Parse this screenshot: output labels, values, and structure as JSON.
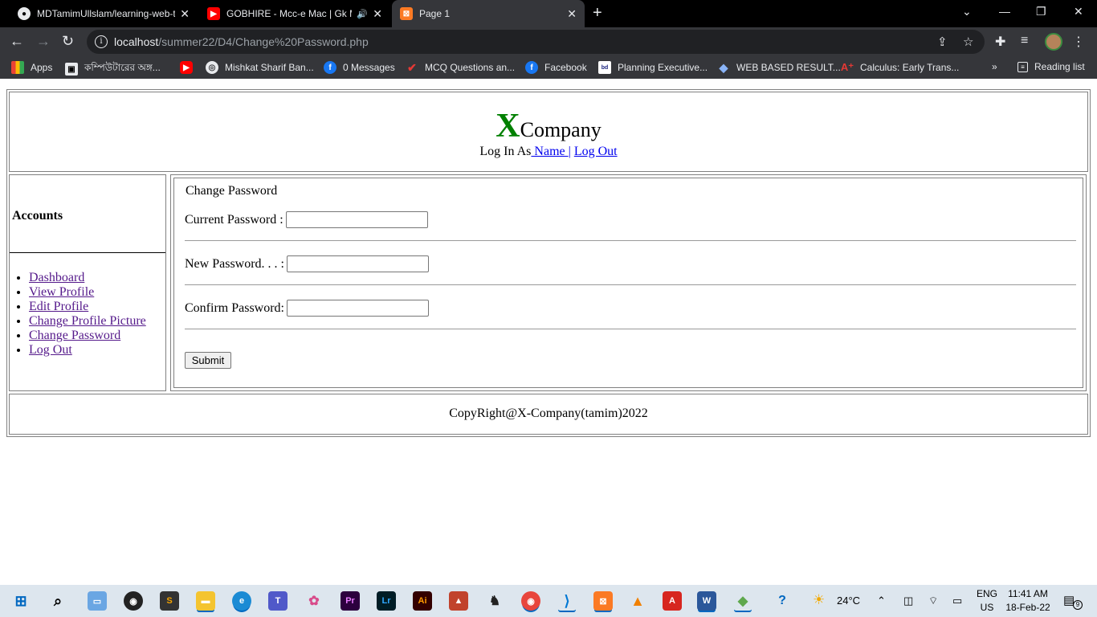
{
  "browser": {
    "tabs": [
      {
        "title": "MDTamimUllslam/learning-web-t",
        "favicon": "github-icon"
      },
      {
        "title": "GOBHIRE - Mcc-e Mac | Gk Ma",
        "favicon": "youtube-icon"
      },
      {
        "title": "Page 1",
        "favicon": "xampp-icon"
      }
    ],
    "url_host": "localhost",
    "url_path": "/summer22/D4/Change%20Password.php",
    "bookmarks": [
      {
        "label": "Apps"
      },
      {
        "label": "কম্পিউটারের অঙ্গ..."
      },
      {
        "label": ""
      },
      {
        "label": "Mishkat Sharif Ban..."
      },
      {
        "label": "0 Messages"
      },
      {
        "label": "MCQ Questions an..."
      },
      {
        "label": "Facebook"
      },
      {
        "label": "Planning Executive..."
      },
      {
        "label": "WEB BASED RESULT..."
      },
      {
        "label": "Calculus: Early Trans..."
      }
    ],
    "more_bookmarks": "»",
    "reading_list": "Reading list"
  },
  "header": {
    "brand_letter": "X",
    "brand_rest": "Company",
    "login_prefix": "Log In As",
    "user_link": " Name ",
    "separator": "|",
    "logout_link": " Log Out"
  },
  "sidebar": {
    "title": "Accounts",
    "items": [
      {
        "label": "Dashboard"
      },
      {
        "label": "View Profile"
      },
      {
        "label": "Edit Profile"
      },
      {
        "label": "Change Profile Picture"
      },
      {
        "label": "Change Password"
      },
      {
        "label": "Log Out"
      }
    ]
  },
  "form": {
    "legend": "Change Password",
    "current_label": "Current Password :",
    "new_label": "New Password. . . :",
    "confirm_label": "Confirm Password:",
    "current_value": "",
    "new_value": "",
    "confirm_value": "",
    "submit_label": "Submit"
  },
  "footer": {
    "text": "CopyRight@X-Company(tamim)2022"
  },
  "taskbar": {
    "weather": "24°C",
    "lang_1": "ENG",
    "lang_2": "US",
    "time": "11:41 AM",
    "date": "18-Feb-22",
    "notifications": "9"
  },
  "colors": {
    "brand_green": "#008000",
    "link_blue": "#0000ee",
    "link_visited": "#551a8b",
    "chrome_dark": "#35363a"
  }
}
